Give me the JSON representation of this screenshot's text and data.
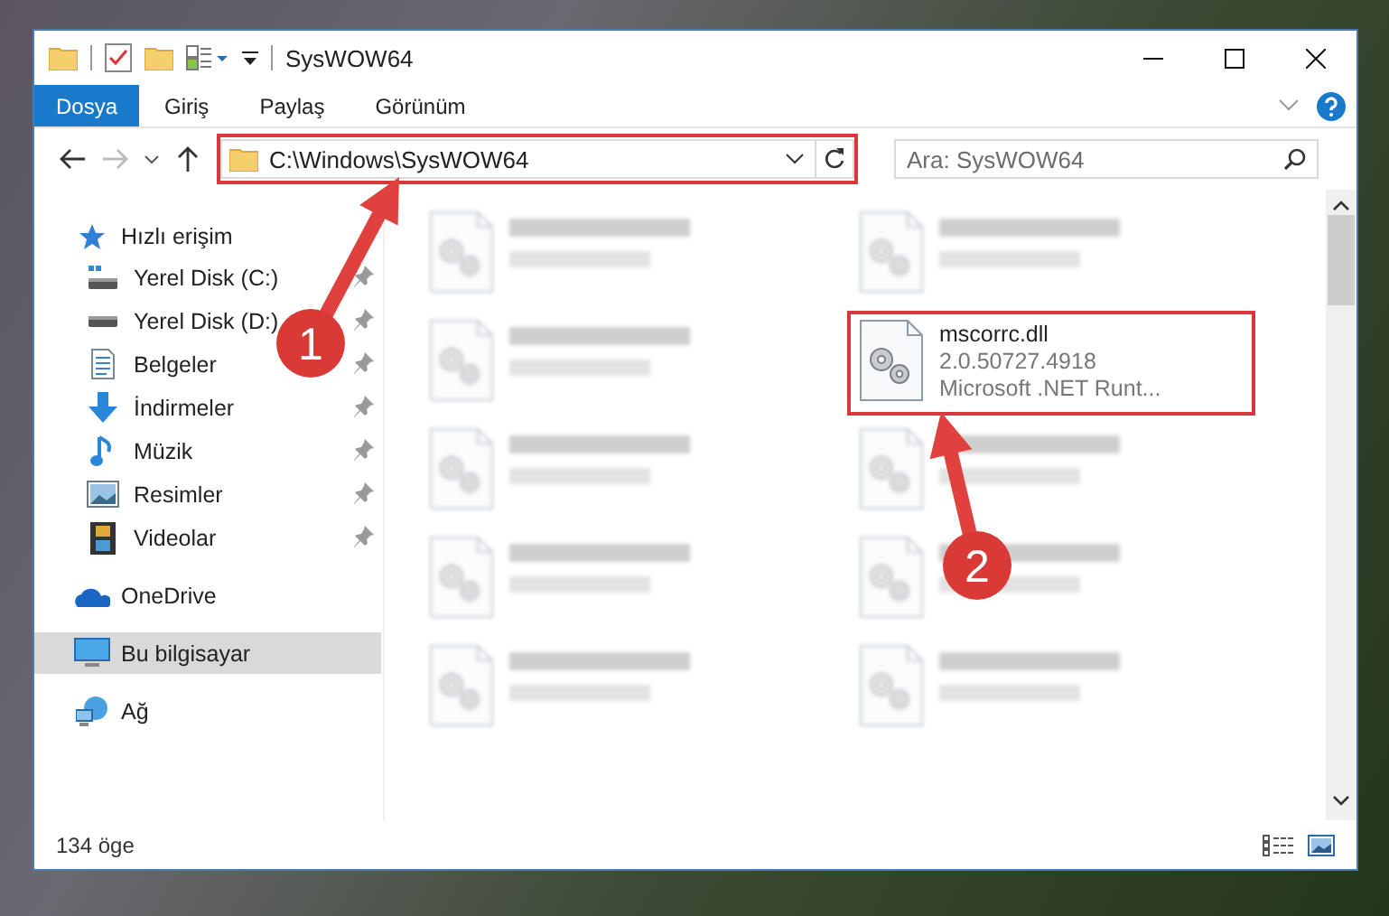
{
  "window": {
    "title": "SysWOW64"
  },
  "ribbon_tabs": [
    {
      "label": "Dosya",
      "selected": true
    },
    {
      "label": "Giriş",
      "selected": false
    },
    {
      "label": "Paylaş",
      "selected": false
    },
    {
      "label": "Görünüm",
      "selected": false
    }
  ],
  "address": {
    "path": "C:\\Windows\\SysWOW64",
    "highlighted": true
  },
  "search": {
    "placeholder": "Ara: SysWOW64"
  },
  "nav_pane": [
    {
      "label": "Hızlı erişim",
      "selected": false,
      "children": [
        {
          "label": "Yerel Disk (C:)",
          "pinned": true,
          "selected": false
        },
        {
          "label": "Yerel Disk (D:)",
          "pinned": true,
          "selected": false
        },
        {
          "label": "Belgeler",
          "pinned": true,
          "selected": false
        },
        {
          "label": "İndirmeler",
          "pinned": true,
          "selected": false
        },
        {
          "label": "Müzik",
          "pinned": true,
          "selected": false
        },
        {
          "label": "Resimler",
          "pinned": true,
          "selected": false
        },
        {
          "label": "Videolar",
          "pinned": true,
          "selected": false
        }
      ]
    },
    {
      "label": "OneDrive",
      "selected": false
    },
    {
      "label": "Bu bilgisayar",
      "selected": true
    },
    {
      "label": "Ağ",
      "selected": false
    }
  ],
  "files": [
    {
      "blurred": true,
      "highlighted": false
    },
    {
      "blurred": true,
      "highlighted": false
    },
    {
      "blurred": true,
      "highlighted": false
    },
    {
      "name": "mscorrc.dll",
      "version": "2.0.50727.4918",
      "description": "Microsoft .NET Runt...",
      "blurred": false,
      "highlighted": true
    },
    {
      "blurred": true,
      "highlighted": false
    },
    {
      "blurred": true,
      "highlighted": false
    },
    {
      "blurred": true,
      "highlighted": false
    },
    {
      "blurred": true,
      "highlighted": false
    },
    {
      "blurred": true,
      "highlighted": false
    },
    {
      "blurred": true,
      "highlighted": false
    }
  ],
  "status_bar": {
    "item_count": "134 öge"
  },
  "annotations": [
    {
      "number": "1"
    },
    {
      "number": "2"
    }
  ]
}
